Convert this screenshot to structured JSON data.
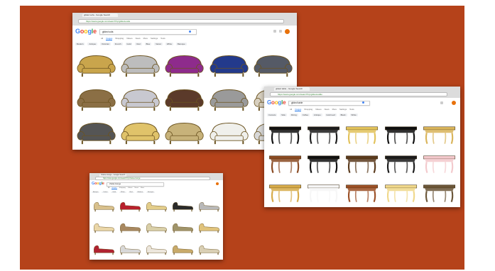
{
  "colors": {
    "stage_bg": "#b5421a",
    "chrome": "#dcdcdc",
    "accent": "#4285f4"
  },
  "logo": {
    "letters": [
      "G",
      "o",
      "o",
      "g",
      "l",
      "e"
    ],
    "colors": [
      "#4285f4",
      "#ea4335",
      "#fbbc05",
      "#4285f4",
      "#34a853",
      "#ea4335"
    ]
  },
  "windows": {
    "sofas": {
      "tab_label": "gilded sofa - Google Search",
      "url": "https://www.google.com/search?q=gilded+sofa",
      "query": "gilded sofa",
      "nav_tabs": [
        "All",
        "Images",
        "Shopping",
        "Videos",
        "News",
        "More",
        "Settings",
        "Tools"
      ],
      "chips": [
        "Modern",
        "Antique",
        "Victorian",
        "French",
        "Gold",
        "Red",
        "Blue",
        "Velvet",
        "White",
        "Baroque"
      ],
      "thumb_icon": "sofa-icon"
    },
    "tables": {
      "tab_label": "gilded table - Google Search",
      "url": "https://www.google.com/search?q=gilded+table",
      "query": "gilded table",
      "nav_tabs": [
        "All",
        "Images",
        "Shopping",
        "Videos",
        "News",
        "More",
        "Settings",
        "Tools"
      ],
      "chips": [
        "Console",
        "Side",
        "Dining",
        "Coffee",
        "Antique",
        "Gold Leaf",
        "Black",
        "White"
      ],
      "thumb_icon": "table-icon"
    },
    "chaises": {
      "tab_label": "chaise lounge - Google Search",
      "url": "https://www.google.com/search?q=chaise+lounge",
      "query": "chaise lounge",
      "nav_tabs": [
        "All",
        "Images",
        "Shopping",
        "Videos",
        "News",
        "More"
      ],
      "chips": [
        "Antique",
        "Velvet",
        "Gold",
        "White",
        "Red",
        "Modern",
        "Baroque"
      ],
      "thumb_icon": "chaise-icon"
    }
  },
  "thumbnails": {
    "sofas": [
      [
        "#c9a54c",
        "#bdbdbd",
        "#8e2b8c",
        "#233a8c",
        "#555a66"
      ],
      [
        "#8b6f45",
        "#c8c8d0",
        "#5b3a2a",
        "#9a9a9a",
        "#d8d0c0"
      ],
      [
        "#555555",
        "#e0c36a",
        "#c7b27a",
        "#f0f0ec",
        "#d8d8d8"
      ]
    ],
    "tables": [
      [
        "#111111",
        "#1c1c1c",
        "#e2c25a",
        "#0e0e0e",
        "#d9b45a"
      ],
      [
        "#8a4a22",
        "#101010",
        "#5a3a1c",
        "#1a1a1a",
        "#f3c9cc"
      ],
      [
        "#d6aa48",
        "#f6f6f6",
        "#9b4f25",
        "#f0d88a",
        "#6b5638"
      ]
    ],
    "chaises": [
      [
        "#d8c08c",
        "#b8202c",
        "#e3cd8a",
        "#2a2a2a",
        "#b8b8b8"
      ],
      [
        "#ead6a8",
        "#a88860",
        "#d9cfa8",
        "#a0946a",
        "#e0c37c"
      ],
      [
        "#b02230",
        "#d8d8d8",
        "#ece6dc",
        "#c8aa6a",
        "#d9cfb4"
      ]
    ]
  }
}
